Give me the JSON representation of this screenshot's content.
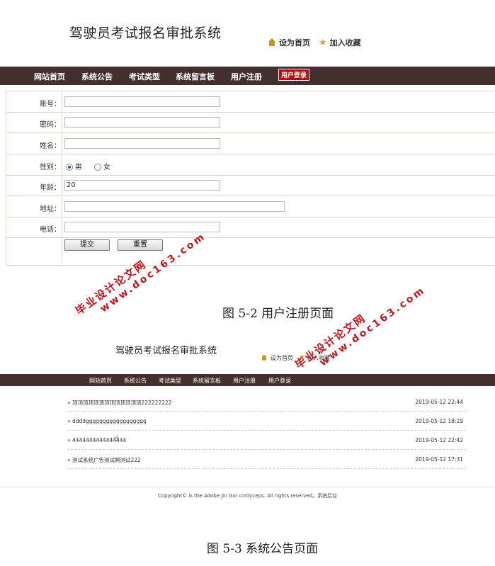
{
  "screen1": {
    "site_title": "驾驶员考试报名审批系统",
    "top_links": [
      {
        "label": "设为首页",
        "icon": "home-icon"
      },
      {
        "label": "加入收藏",
        "icon": "star-icon"
      }
    ],
    "nav": [
      "网站首页",
      "系统公告",
      "考试类型",
      "系统留言板",
      "用户注册",
      "用户登录"
    ],
    "form": {
      "account_label": "账号：",
      "account_value": "",
      "password_label": "密码：",
      "password_value": "",
      "name_label": "姓名：",
      "name_value": "",
      "gender_label": "性别：",
      "gender_options": [
        "男",
        "女"
      ],
      "gender_selected": "男",
      "age_label": "年龄：",
      "age_value": "20",
      "address_label": "地址：",
      "address_value": "",
      "phone_label": "电话：",
      "phone_value": "",
      "submit_label": "提交",
      "reset_label": "重置"
    },
    "caption": "图 5-2 用户注册页面"
  },
  "screen2": {
    "site_title": "驾驶员考试报名审批系统",
    "top_links": [
      {
        "label": "设为首页",
        "icon": "home-icon"
      },
      {
        "label": "加入收藏",
        "icon": "star-icon"
      }
    ],
    "nav": [
      "网站首页",
      "系统公告",
      "考试类型",
      "系统留言板",
      "用户注册",
      "用户登录"
    ],
    "notices": [
      {
        "title": "顶顶顶顶顶顶顶顶顶顶顶顶顶222222222",
        "date": "2019-05-12 22:44"
      },
      {
        "title": "ddddgggggggggggggggggg",
        "date": "2019-05-12 18:19"
      },
      {
        "title": "4444444444444444",
        "date": "2019-05-12 22:42"
      },
      {
        "title": "测试系统广告测试啊测试222",
        "date": "2019-05-12 17:31"
      }
    ],
    "bullet": "»",
    "footer": "Copyright© is the Adobe Jin Gui cordyceps. All rights reserved。系统后台",
    "caption": "图 5-3 系统公告页面"
  },
  "watermark": {
    "line1": "毕业设计论文网",
    "line2": "www.doc163.com"
  },
  "colors": {
    "nav_bg": "#432f2d",
    "watermark": "#c4141a",
    "active_nav": "#b01010"
  }
}
